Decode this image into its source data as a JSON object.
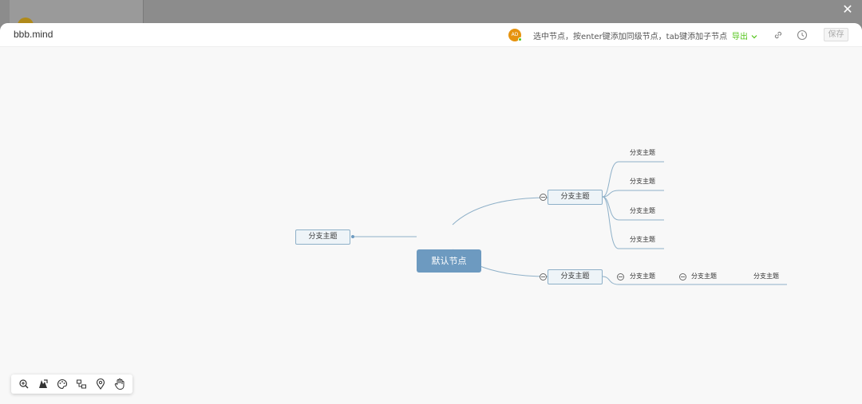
{
  "window": {
    "close_label": "✕"
  },
  "header": {
    "file_title": "bbb.mind",
    "avatar_initials": "AD",
    "hint": "选中节点，按enter键添加同级节点，tab键添加子节点",
    "export_label": "导出",
    "save_label": "保存",
    "icons": [
      "link-icon",
      "history-icon"
    ]
  },
  "mindmap": {
    "root": "默认节点",
    "left_branch": "分支主题",
    "right_branch_top": "分支主题",
    "right_branch_top_children": [
      "分支主题",
      "分支主题",
      "分支主题",
      "分支主题"
    ],
    "right_branch_bottom": "分支主题",
    "right_branch_bottom_chain": [
      "分支主题",
      "分支主题",
      "分支主题"
    ]
  },
  "toolbar": {
    "icons": [
      "zoom-in-icon",
      "map-icon",
      "theme-icon",
      "structure-icon",
      "location-icon",
      "hand-icon"
    ]
  },
  "colors": {
    "root_fill": "#6d9ac0",
    "node_border": "#8eb0c8",
    "export_green": "#52c41a",
    "avatar_orange": "#e6930f"
  }
}
